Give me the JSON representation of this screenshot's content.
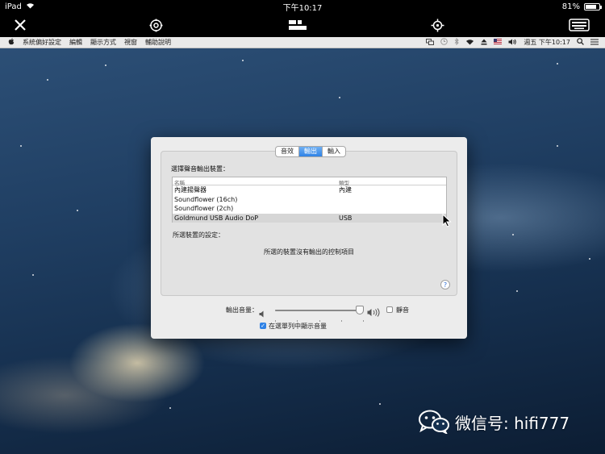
{
  "ios_status": {
    "device": "iPad",
    "time": "下午10:17",
    "battery": "81%",
    "battery_level": 0.81
  },
  "toolbar": {
    "close_icon": "close-icon",
    "settings_icon": "gear-icon",
    "display_icon": "display-layout-icon",
    "move_icon": "crosshair-icon",
    "keyboard_icon": "keyboard-icon"
  },
  "menubar": {
    "apple": "apple-icon",
    "items": [
      "系統偏好設定",
      "編輯",
      "顯示方式",
      "視窗",
      "輔助說明"
    ],
    "clock": "週五 下午10:17"
  },
  "window": {
    "tabs": [
      "音效",
      "輸出",
      "輸入"
    ],
    "active_tab": "輸出",
    "heading": "選擇聲音輸出裝置：",
    "table": {
      "columns": [
        "名稱",
        "類型"
      ],
      "rows": [
        {
          "name": "內建揚聲器",
          "type": "內建"
        },
        {
          "name": "Soundflower (16ch)",
          "type": ""
        },
        {
          "name": "Soundflower (2ch)",
          "type": ""
        },
        {
          "name": "Goldmund USB Audio DoP",
          "type": "USB"
        }
      ],
      "selected_index": 3
    },
    "settings_label": "所選裝置的設定：",
    "no_controls": "所選的裝置沒有輸出的控制項目",
    "help": "?",
    "volume_label": "輸出音量：",
    "volume_level": 0.95,
    "mute_label": "靜音",
    "mute_checked": false,
    "show_in_menubar_label": "在選單列中顯示音量",
    "show_in_menubar_checked": true
  },
  "watermark": {
    "text": "微信号: hifi777"
  }
}
